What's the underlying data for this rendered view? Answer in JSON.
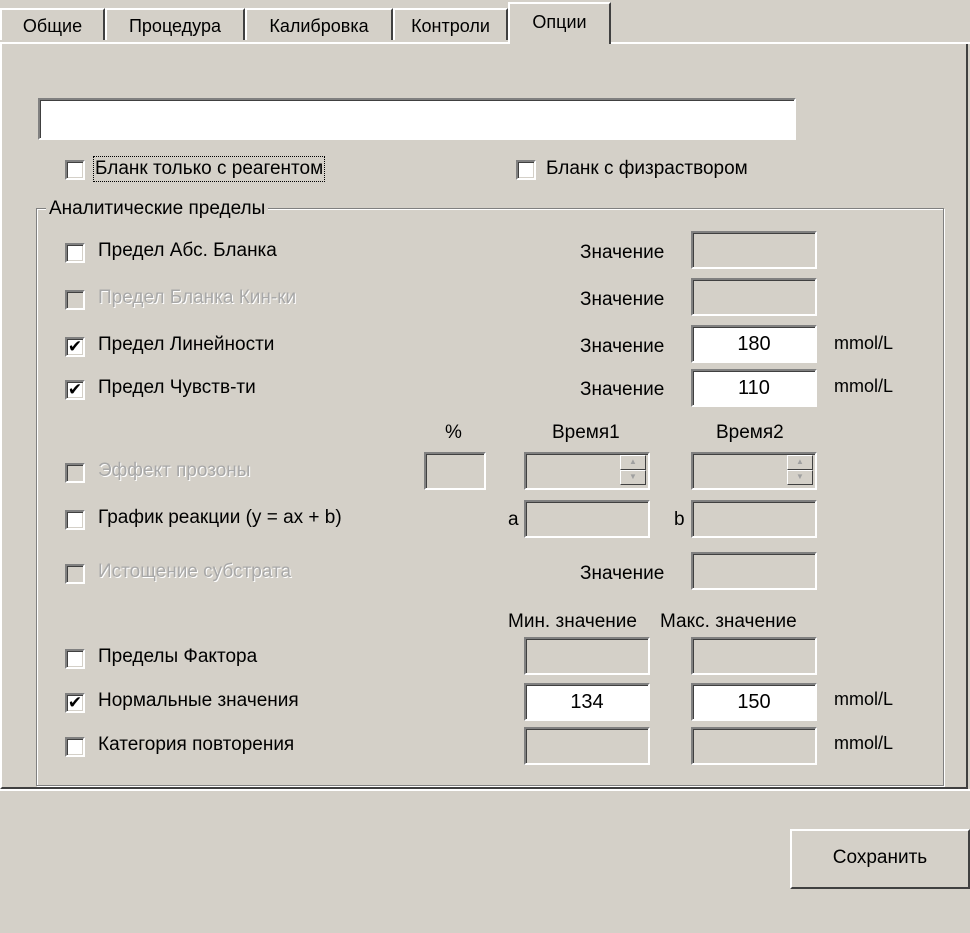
{
  "tabs": [
    "Общие",
    "Процедура",
    "Калибровка",
    "Контроли",
    "Опции"
  ],
  "active_tab": "Опции",
  "top_field_value": "",
  "blank_reagent_only": {
    "label": "Бланк только с реагентом",
    "checked": false
  },
  "blank_saline": {
    "label": "Бланк с физраствором",
    "checked": false
  },
  "group_title": "Аналитические пределы",
  "rows": {
    "abs_blank": {
      "label": "Предел Абс. Бланка",
      "value_label": "Значение",
      "value": "",
      "checked": false
    },
    "kin_blank": {
      "label": "Предел Бланка Кин-ки",
      "value_label": "Значение",
      "value": "",
      "checked": false
    },
    "linearity": {
      "label": "Предел Линейности",
      "value_label": "Значение",
      "value": "180",
      "unit": "mmol/L",
      "checked": true
    },
    "sensitivity": {
      "label": "Предел Чувств-ти",
      "value_label": "Значение",
      "value": "110",
      "unit": "mmol/L",
      "checked": true
    },
    "prozone": {
      "label": "Эффект прозоны",
      "pct_header": "%",
      "time1_header": "Время1",
      "time2_header": "Время2",
      "checked": false
    },
    "reaction_graph": {
      "label": "График реакции (y = ax + b)",
      "a_label": "a",
      "b_label": "b",
      "checked": false
    },
    "substrate": {
      "label": "Истощение субстрата",
      "value_label": "Значение",
      "value": "",
      "checked": false
    },
    "factor_limits": {
      "label": "Пределы Фактора",
      "checked": false
    },
    "normal_values": {
      "label": "Нормальные значения",
      "min": "134",
      "max": "150",
      "unit": "mmol/L",
      "checked": true
    },
    "repeat_category": {
      "label": "Категория повторения",
      "unit": "mmol/L",
      "checked": false
    }
  },
  "min_header": "Мин. значение",
  "max_header": "Макс. значение",
  "save_label": "Сохранить",
  "check_mark": "✔"
}
